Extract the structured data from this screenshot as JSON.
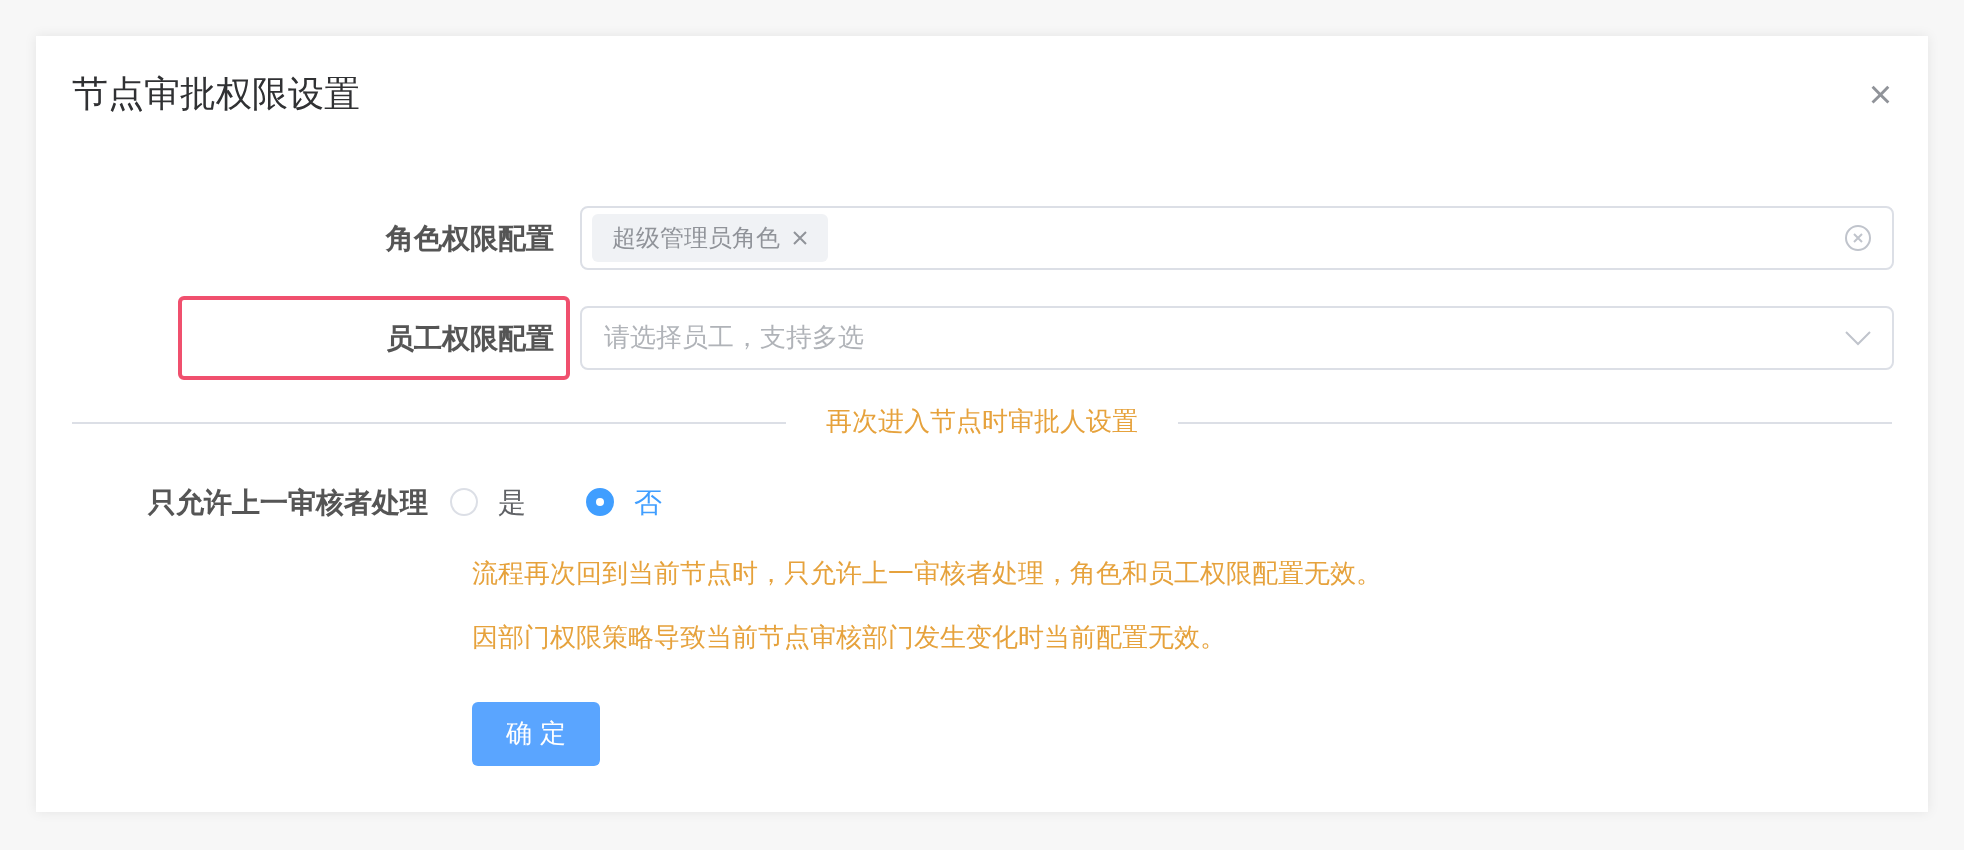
{
  "dialog": {
    "title": "节点审批权限设置",
    "close": "×"
  },
  "fields": [
    {
      "kind": "tags",
      "label": "角色权限配置",
      "highlighted": false,
      "tags": [
        {
          "text": "超级管理员角色"
        }
      ]
    },
    {
      "kind": "select",
      "label": "员工权限配置",
      "highlighted": true,
      "placeholder": "请选择员工，支持多选"
    }
  ],
  "divider": {
    "text": "再次进入节点时审批人设置"
  },
  "radio_group": {
    "label": "只允许上一审核者处理",
    "options": [
      {
        "label": "是",
        "selected": false
      },
      {
        "label": "否",
        "selected": true
      }
    ]
  },
  "notes": [
    "流程再次回到当前节点时，只允许上一审核者处理，角色和员工权限配置无效。",
    "因部门权限策略导致当前节点审核部门发生变化时当前配置无效。"
  ],
  "submit": "确 定"
}
